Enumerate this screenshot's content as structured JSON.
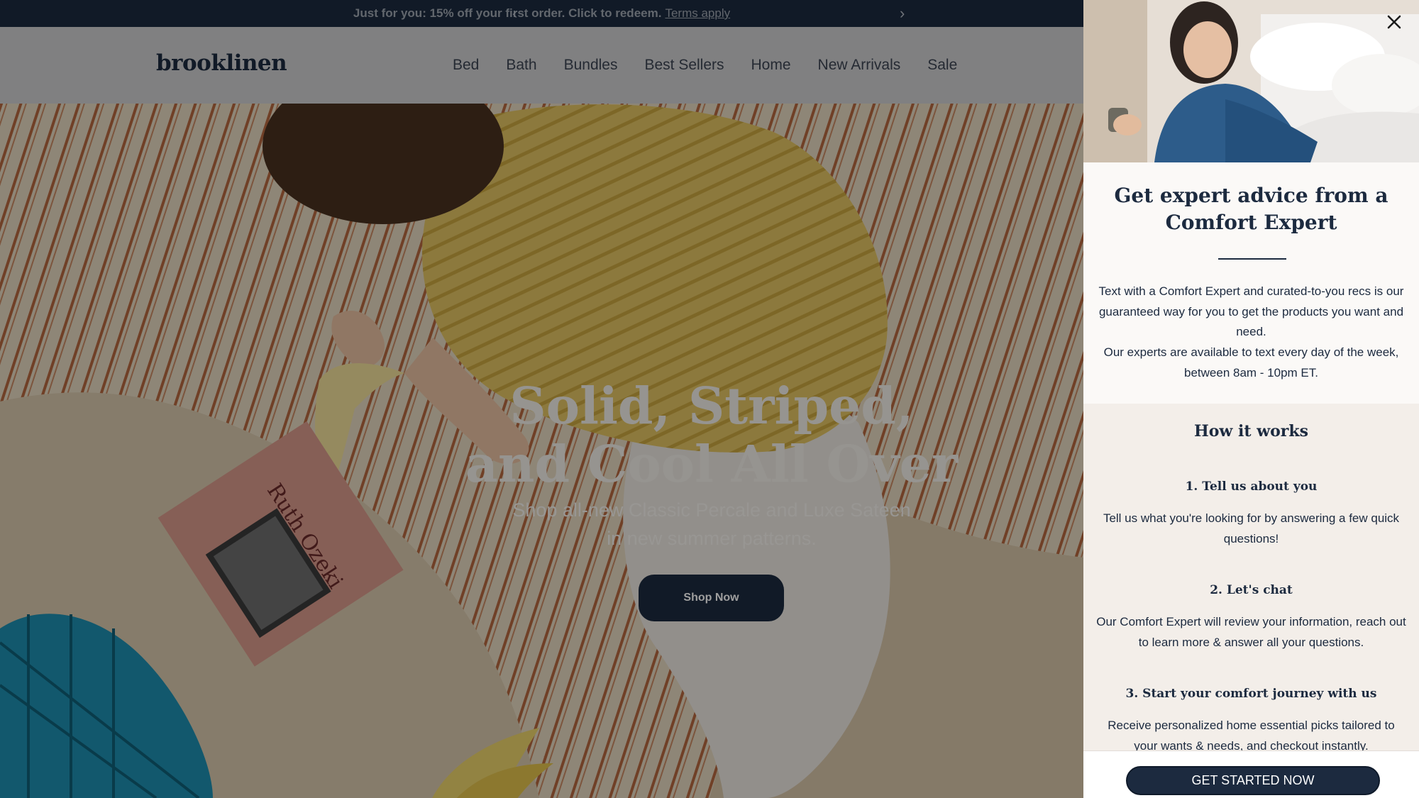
{
  "announcement": {
    "text": "Just for you: 15% off your first order. Click to redeem.",
    "terms_link": "Terms apply",
    "prev_icon": "chevron-left-icon",
    "next_icon": "chevron-right-icon"
  },
  "header": {
    "logo": "brooklinen",
    "nav": [
      "Bed",
      "Bath",
      "Bundles",
      "Best Sellers",
      "Home",
      "New Arrivals",
      "Sale"
    ]
  },
  "hero": {
    "title_line1": "Solid, Striped,",
    "title_line2": "and Cool All Over",
    "subtitle_line1": "Shop all-new Classic Percale and Luxe Sateen",
    "subtitle_line2": "in new summer patterns.",
    "button": "Shop Now",
    "book_text": "Ruth Ozeki"
  },
  "drawer": {
    "close_icon": "close-icon",
    "heading": "Get expert advice from a Comfort Expert",
    "intro_p1": "Text with a Comfort Expert and curated-to-you recs is our guaranteed way for you to get the products you want and need.",
    "intro_p2": "Our experts are available to text every day of the week, between 8am - 10pm ET.",
    "how_heading": "How it works",
    "steps": [
      {
        "title": "1. Tell us about you",
        "text": "Tell us what you're looking for by answering a few quick questions!"
      },
      {
        "title": "2. Let's chat",
        "text": "Our Comfort Expert will review your information, reach out to learn more & answer all your questions."
      },
      {
        "title": "3. Start your comfort journey with us",
        "text": "Receive personalized home essential picks tailored to your wants & needs, and checkout instantly."
      }
    ],
    "cta": "GET STARTED NOW"
  },
  "colors": {
    "navy": "#1c2a3f",
    "drawer_bg": "#f3eee9",
    "overlay": "rgba(0,0,0,0.38)"
  }
}
